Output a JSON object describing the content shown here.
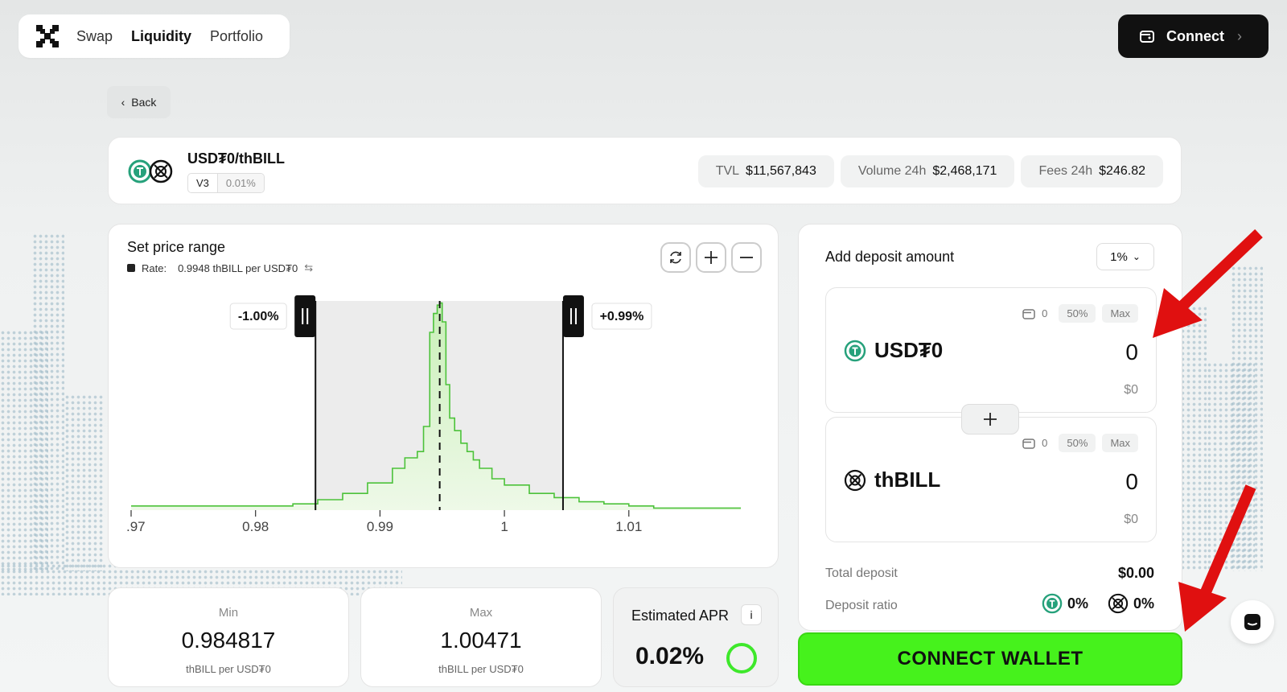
{
  "nav": {
    "items": [
      {
        "label": "Swap",
        "active": false
      },
      {
        "label": "Liquidity",
        "active": true
      },
      {
        "label": "Portfolio",
        "active": false
      }
    ],
    "connect_label": "Connect"
  },
  "back_label": "Back",
  "pool": {
    "name": "USD₮0/thBILL",
    "version": "V3",
    "fee_tier": "0.01%",
    "stats": [
      {
        "label": "TVL",
        "value": "$11,567,843"
      },
      {
        "label": "Volume 24h",
        "value": "$2,468,171"
      },
      {
        "label": "Fees 24h",
        "value": "$246.82"
      }
    ]
  },
  "range": {
    "title": "Set price range",
    "rate_label": "Rate:",
    "rate_value": "0.9948 thBILL per USD₮0",
    "lower_pct": "-1.00%",
    "upper_pct": "+0.99%"
  },
  "chart_data": {
    "type": "area",
    "x_tick_labels": [
      ".97",
      "0.98",
      "0.99",
      "1",
      "1.01"
    ],
    "x_ticks": [
      0.97,
      0.98,
      0.99,
      1.0,
      1.01
    ],
    "xlim": [
      0.97,
      1.019
    ],
    "current_price": 0.9948,
    "range_min": 0.984817,
    "range_max": 1.00471,
    "series": [
      {
        "x": [
          0.97,
          0.975,
          0.98,
          0.983,
          0.985,
          0.987,
          0.989,
          0.991,
          0.992,
          0.993,
          0.9935,
          0.994,
          0.9943,
          0.9946,
          0.9948,
          0.995,
          0.9953,
          0.9956,
          0.996,
          0.9965,
          0.997,
          0.9975,
          0.998,
          0.999,
          1.0,
          1.002,
          1.004,
          1.006,
          1.008,
          1.01,
          1.012,
          1.015,
          1.019
        ],
        "y": [
          2,
          2,
          2,
          3,
          5,
          8,
          13,
          20,
          25,
          28,
          40,
          85,
          94,
          98,
          99,
          90,
          60,
          44,
          38,
          32,
          28,
          24,
          20,
          15,
          12,
          8,
          6,
          4,
          3,
          2,
          1,
          1,
          1
        ]
      }
    ]
  },
  "min": {
    "title": "Min",
    "value": "0.984817",
    "unit": "thBILL per USD₮0"
  },
  "max": {
    "title": "Max",
    "value": "1.00471",
    "unit": "thBILL per USD₮0"
  },
  "apr": {
    "title": "Estimated APR",
    "info": "i",
    "value": "0.02%"
  },
  "deposit": {
    "title": "Add deposit amount",
    "slippage": "1%",
    "tokens": [
      {
        "symbol": "USD₮0",
        "balance": "0",
        "half": "50%",
        "max": "Max",
        "amount": "0",
        "usd": "$0"
      },
      {
        "symbol": "thBILL",
        "balance": "0",
        "half": "50%",
        "max": "Max",
        "amount": "0",
        "usd": "$0"
      }
    ],
    "total_label": "Total deposit",
    "total_value": "$0.00",
    "ratio_label": "Deposit ratio",
    "ratio_a": "0%",
    "ratio_b": "0%"
  },
  "cta_label": "CONNECT WALLET",
  "colors": {
    "accent_green": "#46f21c",
    "chart_fill": "#c9efb8",
    "chart_line": "#4cc23a",
    "tether_green": "#26a17b"
  }
}
